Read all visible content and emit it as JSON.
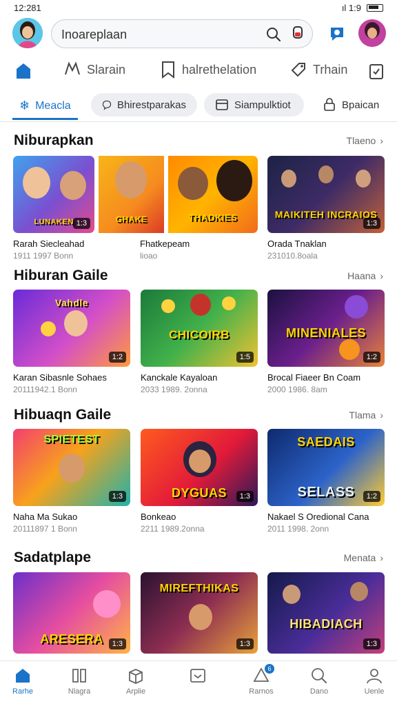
{
  "status_bar": {
    "time": "12:281",
    "right_text": "ıl 1:9"
  },
  "search": {
    "value": "Inoareplaan"
  },
  "categories": [
    {
      "label": "Slarain",
      "icon": "controller-icon"
    },
    {
      "label": "halrethelation",
      "icon": "bookmark-icon"
    },
    {
      "label": "Trhain",
      "icon": "tag-icon"
    }
  ],
  "tabs": [
    {
      "label": "Meacla",
      "icon": "snowflake-icon",
      "active": true
    },
    {
      "label": "Bhirestparakas",
      "icon": "chat-bubble-icon"
    },
    {
      "label": "Siampulktiot",
      "icon": "window-icon"
    },
    {
      "label": "Bpaican",
      "icon": "lock-icon"
    }
  ],
  "sections": [
    {
      "title": "Niburapkan",
      "more": "Tlaeno",
      "cards": [
        {
          "thumb_text": "LUNAKEN",
          "badge": "1:3",
          "title": "Rarah Siecleahad",
          "meta": "1911 1997 Bonn"
        },
        {
          "thumb_text": "GHAKE",
          "badge": "",
          "title": "Fhatkepeam",
          "meta": "lioao"
        },
        {
          "thumb_text": "THADKIES",
          "badge": "",
          "title": "",
          "meta": ""
        },
        {
          "thumb_text": "MAIKITEH INCRAIOS",
          "badge": "1:3",
          "title": "Orada Tnaklan",
          "meta": "231010.8oala"
        }
      ]
    },
    {
      "title": "Hiburan Gaile",
      "more": "Haana",
      "cards": [
        {
          "thumb_text": "Vahdle",
          "badge": "1:2",
          "title": "Karan Sibasnle Sohaes",
          "meta": "20111942.1 Bonn"
        },
        {
          "thumb_text": "CHICOIRB",
          "badge": "1:5",
          "title": "Kanckale Kayaloan",
          "meta": "2033 1989. 2onna"
        },
        {
          "thumb_text": "MINENIALES",
          "badge": "1:2",
          "title": "Brocal Fiaeer Bn Coam",
          "meta": "2000 1986. 8am"
        }
      ]
    },
    {
      "title": "Hibuaqn Gaile",
      "more": "Tlama",
      "cards": [
        {
          "thumb_text": "SPIETEST",
          "badge": "1:3",
          "title": "Naha Ma Sukao",
          "meta": "20111897 1 Bonn"
        },
        {
          "thumb_text": "DYGUAS",
          "badge": "1:3",
          "title": "Bonkeao",
          "meta": "2211 1989.2onna"
        },
        {
          "thumb_text": "SELASS",
          "badge": "1:2",
          "title": "Nakael S Oredional Cana",
          "meta": "2011 1998. 2onn"
        }
      ]
    },
    {
      "title": "Sadatplape",
      "more": "Menata",
      "cards": [
        {
          "thumb_text": "ARESERA",
          "badge": "1:3",
          "title": "",
          "meta": ""
        },
        {
          "thumb_text": "MIREFTHIKAS",
          "badge": "1:3",
          "title": "",
          "meta": ""
        },
        {
          "thumb_text": "HIBADIACH",
          "badge": "1:3",
          "title": "",
          "meta": ""
        }
      ]
    }
  ],
  "bottom_nav": [
    {
      "label": "Rarhe",
      "icon": "home-icon",
      "active": true
    },
    {
      "label": "Nlagra",
      "icon": "book-icon"
    },
    {
      "label": "Arplie",
      "icon": "box-icon"
    },
    {
      "label": "",
      "icon": "inbox-icon"
    },
    {
      "label": "Rarnos",
      "icon": "bell-icon",
      "notification": "6"
    },
    {
      "label": "Dano",
      "icon": "search-icon"
    },
    {
      "label": "Uenle",
      "icon": "profile-icon"
    }
  ],
  "colors": {
    "accent": "#1a73c8",
    "pill_bg": "#eceef2",
    "divider": "#e2e4e8"
  }
}
